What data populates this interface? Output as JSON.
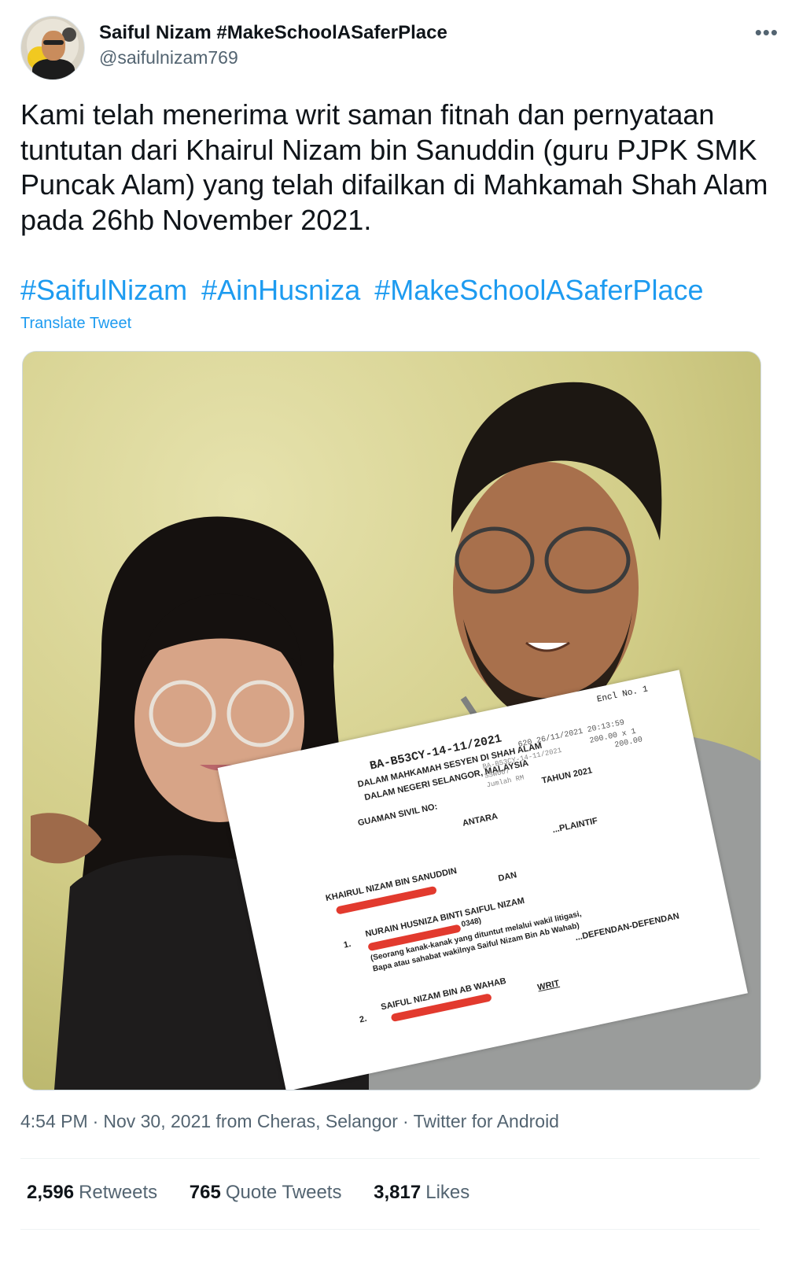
{
  "author": {
    "display_name": "Saiful Nizam #MakeSchoolASaferPlace",
    "handle": "@saifulnizam769",
    "avatar_icon": "profile-avatar"
  },
  "tweet": {
    "text": "Kami telah menerima writ saman fitnah dan pernyataan tuntutan dari Khairul Nizam bin Sanuddin (guru PJPK SMK Puncak Alam) yang telah difailkan di Mahkamah Shah Alam pada 26hb November 2021.",
    "hashtags": [
      "#SaifulNizam",
      "#AinHusniza",
      "#MakeSchoolASaferPlace"
    ],
    "translate_label": "Translate Tweet"
  },
  "media": {
    "document": {
      "encl": "Encl No. 1",
      "case_no": "BA-B53CY-14-11/2021",
      "court": "DALAM MAHKAMAH SESYEN DI SHAH ALAM",
      "state": "DALAM NEGERI SELANGOR, MALAYSIA",
      "stamp_line1": "620 26/11/2021 20:13:59",
      "stamp_line2": "200.00 x 1",
      "stamp_line3": "200.00",
      "stamp_code1": "BA-B53CY-14-11/2021",
      "stamp_code2": "SSW007",
      "stamp_code3": "Jumlah RM",
      "guaman": "GUAMAN SIVIL NO:",
      "tahun": "TAHUN 2021",
      "antara": "ANTARA",
      "plaintif": "...PLAINTIF",
      "plaintiff_name": "KHAIRUL NIZAM BIN SANUDDIN",
      "dan": "DAN",
      "item1_no": "1.",
      "defendant1": "NURAIN HUSNIZA BINTI SAIFUL NIZAM",
      "defendant1_id": "0348)",
      "defendant1_note1": "(Seorang kanak-kanak yang dituntut melalui wakil litigasi,",
      "defendant1_note2": "Bapa atau sahabat wakilnya Saiful Nizam Bin Ab Wahab)",
      "defendan": "...DEFENDAN-DEFENDAN",
      "item2_no": "2.",
      "defendant2": "SAIFUL NIZAM BIN AB WAHAB",
      "writ": "WRIT"
    }
  },
  "meta": {
    "time": "4:54 PM",
    "date": "Nov 30, 2021",
    "location": "from Cheras, Selangor",
    "client": "Twitter for Android",
    "separator": "·"
  },
  "stats": {
    "retweets_count": "2,596",
    "retweets_label": "Retweets",
    "quotes_count": "765",
    "quotes_label": "Quote Tweets",
    "likes_count": "3,817",
    "likes_label": "Likes"
  },
  "colors": {
    "link": "#1d9bf0",
    "secondary_text": "#536471",
    "primary_text": "#0f1419"
  }
}
